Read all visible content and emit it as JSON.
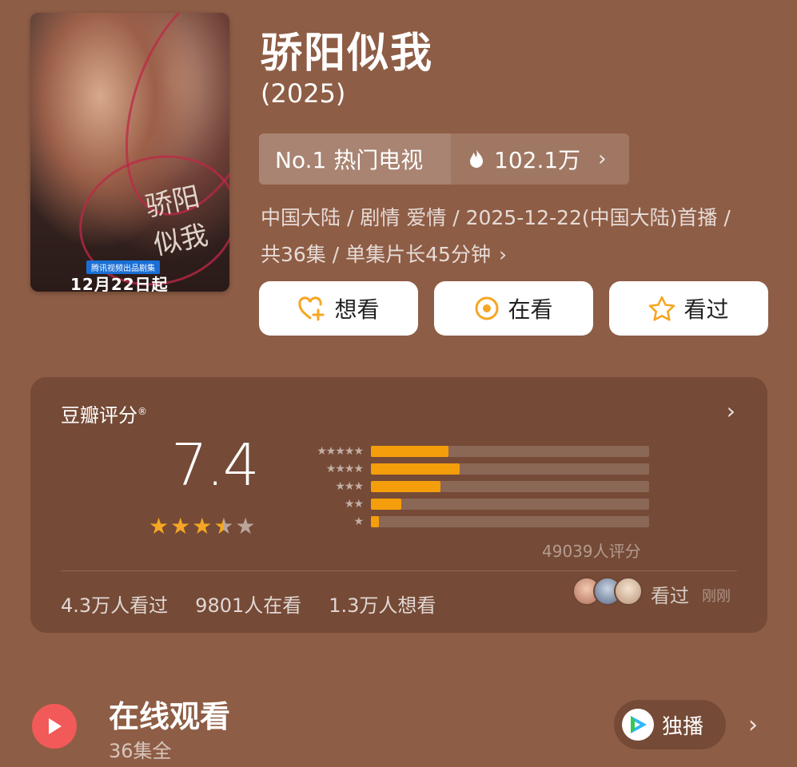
{
  "poster": {
    "calligraphy": "骄阳似我",
    "platform_label": "腾讯视频出品剧集",
    "date_text": "12月22日起"
  },
  "show": {
    "title": "骄阳似我",
    "year": "(2025)"
  },
  "rank": {
    "label": "No.1 热门电视",
    "heat": "102.1万",
    "heat_icon": "fire-icon"
  },
  "meta": {
    "line1": "中国大陆 / 剧情 爱情 / 2025-12-22(中国大陆)首播 /",
    "line2": "共36集 / 单集片长45分钟"
  },
  "actions": [
    {
      "label": "想看",
      "icon": "heart-plus-icon"
    },
    {
      "label": "在看",
      "icon": "target-icon"
    },
    {
      "label": "看过",
      "icon": "star-outline-icon"
    }
  ],
  "rating": {
    "title": "豆瓣评分",
    "registered": "®",
    "score": "7.4",
    "stars_value": 3.5,
    "distribution_levels": [
      0.28,
      0.32,
      0.25,
      0.11,
      0.03
    ],
    "count_text": "49039人评分",
    "stats": [
      "4.3万人看过",
      "9801人在看",
      "1.3万人想看"
    ],
    "recent_action": "看过",
    "recent_time": "刚刚"
  },
  "watch": {
    "title": "在线观看",
    "subtitle": "36集全",
    "badge": "独播"
  },
  "colors": {
    "background": "#8e5d45",
    "accent": "#f59e0b",
    "play": "#f15a58"
  }
}
